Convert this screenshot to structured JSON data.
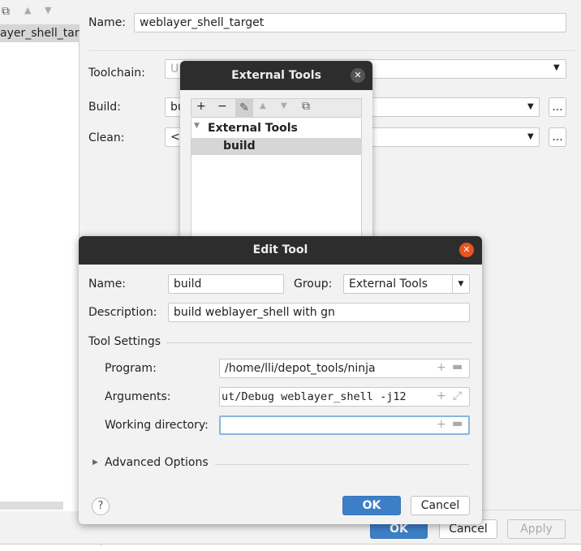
{
  "left_panel": {
    "selected_item": "ayer_shell_targ"
  },
  "config": {
    "name_label": "Name:",
    "name_value": "weblayer_shell_target",
    "toolchain_label": "Toolchain:",
    "toolchain_value": "U",
    "build_label": "Build:",
    "build_value": "bu",
    "clean_label": "Clean:",
    "clean_value": "<N",
    "browse_label": "...",
    "ok": "OK",
    "cancel": "Cancel",
    "apply": "Apply",
    "bottom_fragment": "...................;"
  },
  "external_tools": {
    "title": "External Tools",
    "tree": {
      "group": "External Tools",
      "items": [
        "build"
      ]
    }
  },
  "edit_tool": {
    "title": "Edit Tool",
    "name_label": "Name:",
    "name_value": "build",
    "group_label": "Group:",
    "group_value": "External Tools",
    "description_label": "Description:",
    "description_value": "build weblayer_shell with gn",
    "tool_settings": "Tool Settings",
    "program_label": "Program:",
    "program_value": "/home/lli/depot_tools/ninja",
    "arguments_label": "Arguments:",
    "arguments_value": "ut/Debug weblayer_shell -j12",
    "workdir_label": "Working directory:",
    "workdir_value": "",
    "advanced": "Advanced Options",
    "help": "?",
    "ok": "OK",
    "cancel": "Cancel"
  },
  "colors": {
    "accent": "#3d7fc7",
    "close_active": "#e95420",
    "titlebar": "#2d2d2d"
  }
}
